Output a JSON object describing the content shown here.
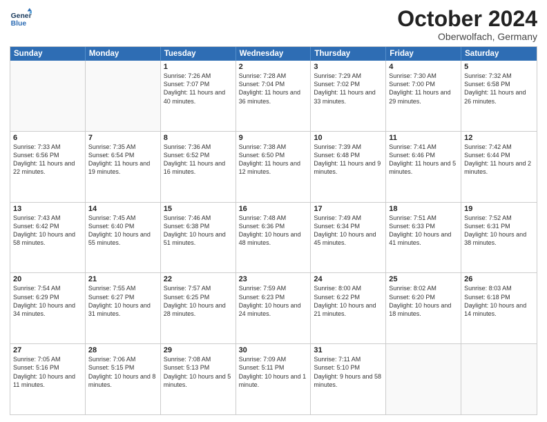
{
  "header": {
    "logo_line1": "General",
    "logo_line2": "Blue",
    "month": "October 2024",
    "location": "Oberwolfach, Germany"
  },
  "weekdays": [
    "Sunday",
    "Monday",
    "Tuesday",
    "Wednesday",
    "Thursday",
    "Friday",
    "Saturday"
  ],
  "weeks": [
    [
      {
        "day": "",
        "text": ""
      },
      {
        "day": "",
        "text": ""
      },
      {
        "day": "1",
        "text": "Sunrise: 7:26 AM\nSunset: 7:07 PM\nDaylight: 11 hours and 40 minutes."
      },
      {
        "day": "2",
        "text": "Sunrise: 7:28 AM\nSunset: 7:04 PM\nDaylight: 11 hours and 36 minutes."
      },
      {
        "day": "3",
        "text": "Sunrise: 7:29 AM\nSunset: 7:02 PM\nDaylight: 11 hours and 33 minutes."
      },
      {
        "day": "4",
        "text": "Sunrise: 7:30 AM\nSunset: 7:00 PM\nDaylight: 11 hours and 29 minutes."
      },
      {
        "day": "5",
        "text": "Sunrise: 7:32 AM\nSunset: 6:58 PM\nDaylight: 11 hours and 26 minutes."
      }
    ],
    [
      {
        "day": "6",
        "text": "Sunrise: 7:33 AM\nSunset: 6:56 PM\nDaylight: 11 hours and 22 minutes."
      },
      {
        "day": "7",
        "text": "Sunrise: 7:35 AM\nSunset: 6:54 PM\nDaylight: 11 hours and 19 minutes."
      },
      {
        "day": "8",
        "text": "Sunrise: 7:36 AM\nSunset: 6:52 PM\nDaylight: 11 hours and 16 minutes."
      },
      {
        "day": "9",
        "text": "Sunrise: 7:38 AM\nSunset: 6:50 PM\nDaylight: 11 hours and 12 minutes."
      },
      {
        "day": "10",
        "text": "Sunrise: 7:39 AM\nSunset: 6:48 PM\nDaylight: 11 hours and 9 minutes."
      },
      {
        "day": "11",
        "text": "Sunrise: 7:41 AM\nSunset: 6:46 PM\nDaylight: 11 hours and 5 minutes."
      },
      {
        "day": "12",
        "text": "Sunrise: 7:42 AM\nSunset: 6:44 PM\nDaylight: 11 hours and 2 minutes."
      }
    ],
    [
      {
        "day": "13",
        "text": "Sunrise: 7:43 AM\nSunset: 6:42 PM\nDaylight: 10 hours and 58 minutes."
      },
      {
        "day": "14",
        "text": "Sunrise: 7:45 AM\nSunset: 6:40 PM\nDaylight: 10 hours and 55 minutes."
      },
      {
        "day": "15",
        "text": "Sunrise: 7:46 AM\nSunset: 6:38 PM\nDaylight: 10 hours and 51 minutes."
      },
      {
        "day": "16",
        "text": "Sunrise: 7:48 AM\nSunset: 6:36 PM\nDaylight: 10 hours and 48 minutes."
      },
      {
        "day": "17",
        "text": "Sunrise: 7:49 AM\nSunset: 6:34 PM\nDaylight: 10 hours and 45 minutes."
      },
      {
        "day": "18",
        "text": "Sunrise: 7:51 AM\nSunset: 6:33 PM\nDaylight: 10 hours and 41 minutes."
      },
      {
        "day": "19",
        "text": "Sunrise: 7:52 AM\nSunset: 6:31 PM\nDaylight: 10 hours and 38 minutes."
      }
    ],
    [
      {
        "day": "20",
        "text": "Sunrise: 7:54 AM\nSunset: 6:29 PM\nDaylight: 10 hours and 34 minutes."
      },
      {
        "day": "21",
        "text": "Sunrise: 7:55 AM\nSunset: 6:27 PM\nDaylight: 10 hours and 31 minutes."
      },
      {
        "day": "22",
        "text": "Sunrise: 7:57 AM\nSunset: 6:25 PM\nDaylight: 10 hours and 28 minutes."
      },
      {
        "day": "23",
        "text": "Sunrise: 7:59 AM\nSunset: 6:23 PM\nDaylight: 10 hours and 24 minutes."
      },
      {
        "day": "24",
        "text": "Sunrise: 8:00 AM\nSunset: 6:22 PM\nDaylight: 10 hours and 21 minutes."
      },
      {
        "day": "25",
        "text": "Sunrise: 8:02 AM\nSunset: 6:20 PM\nDaylight: 10 hours and 18 minutes."
      },
      {
        "day": "26",
        "text": "Sunrise: 8:03 AM\nSunset: 6:18 PM\nDaylight: 10 hours and 14 minutes."
      }
    ],
    [
      {
        "day": "27",
        "text": "Sunrise: 7:05 AM\nSunset: 5:16 PM\nDaylight: 10 hours and 11 minutes."
      },
      {
        "day": "28",
        "text": "Sunrise: 7:06 AM\nSunset: 5:15 PM\nDaylight: 10 hours and 8 minutes."
      },
      {
        "day": "29",
        "text": "Sunrise: 7:08 AM\nSunset: 5:13 PM\nDaylight: 10 hours and 5 minutes."
      },
      {
        "day": "30",
        "text": "Sunrise: 7:09 AM\nSunset: 5:11 PM\nDaylight: 10 hours and 1 minute."
      },
      {
        "day": "31",
        "text": "Sunrise: 7:11 AM\nSunset: 5:10 PM\nDaylight: 9 hours and 58 minutes."
      },
      {
        "day": "",
        "text": ""
      },
      {
        "day": "",
        "text": ""
      }
    ]
  ]
}
